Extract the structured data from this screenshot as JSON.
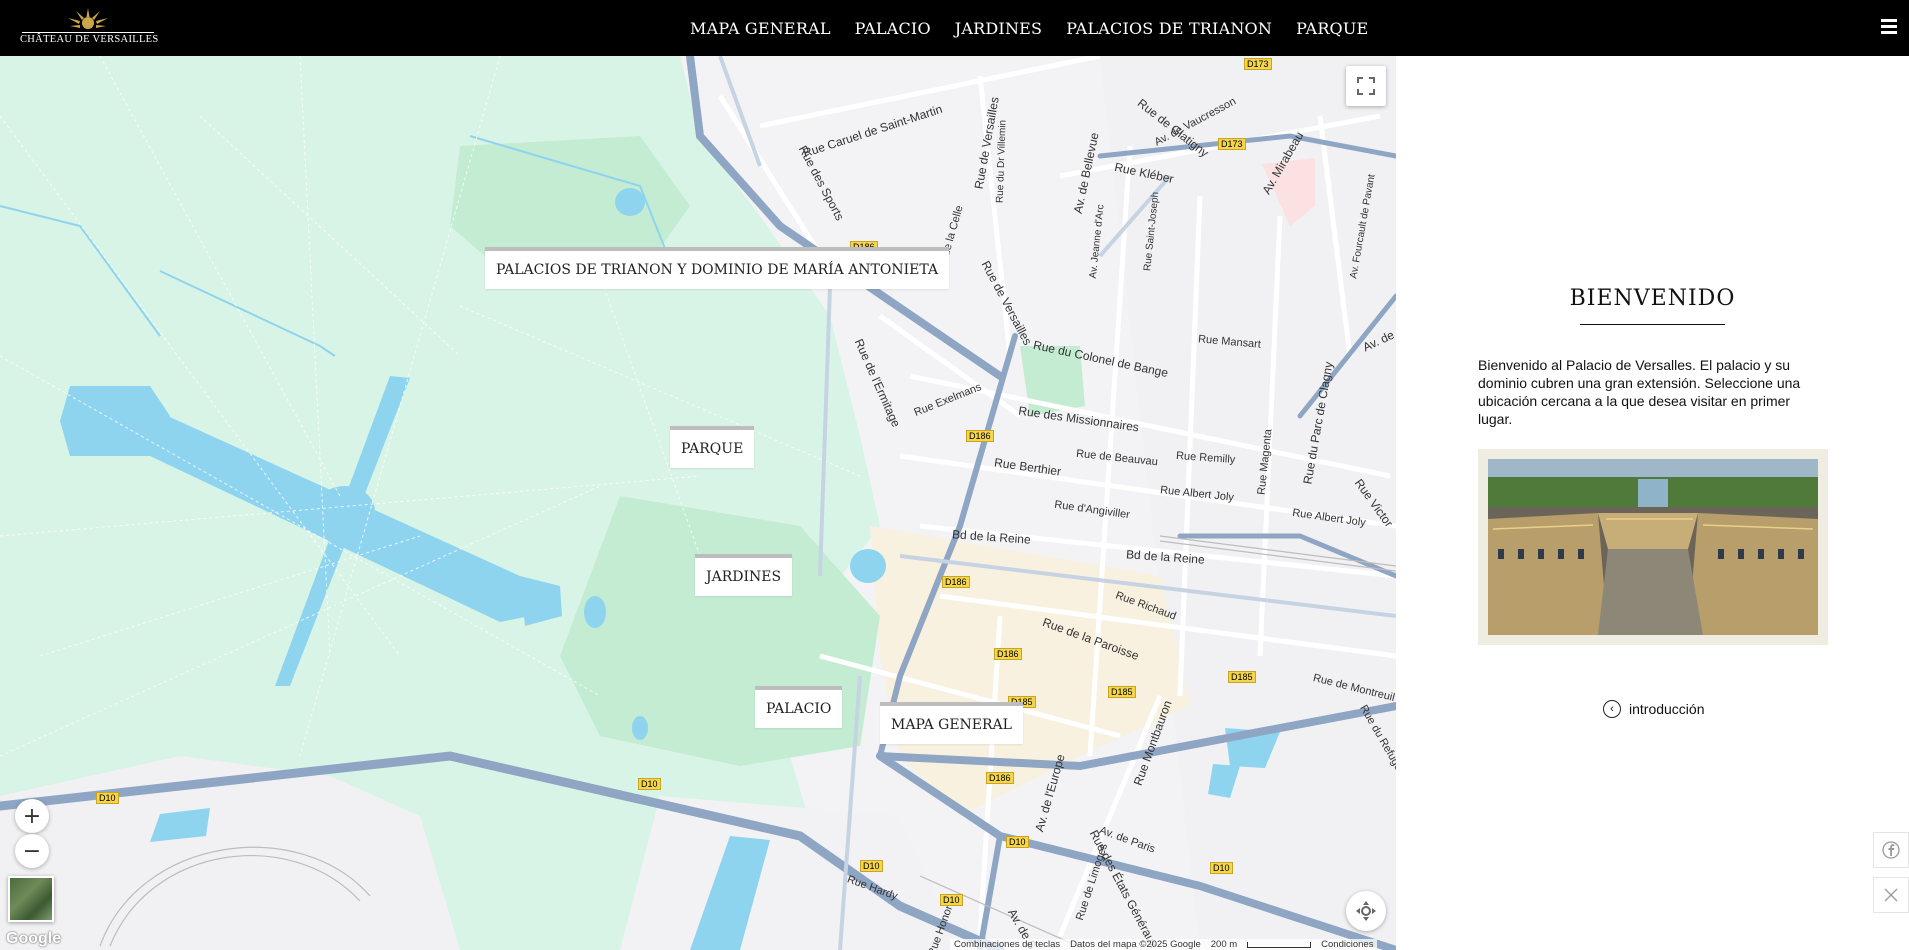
{
  "header": {
    "logo_text": "CHÂTEAU DE VERSAILLES",
    "nav": [
      {
        "label": "MAPA GENERAL"
      },
      {
        "label": "PALACIO"
      },
      {
        "label": "JARDINES"
      },
      {
        "label": "PALACIOS DE TRIANON"
      },
      {
        "label": "PARQUE"
      }
    ],
    "menu_icon": "hamburger-icon"
  },
  "map": {
    "poi_labels": {
      "trianon": "PALACIOS DE TRIANON Y DOMINIO DE MARÍA ANTONIETA",
      "parque": "PARQUE",
      "jardines": "JARDINES",
      "palacio": "PALACIO",
      "mapa_general": "MAPA GENERAL"
    },
    "streets": {
      "caruel": "Rue Caruel de Saint-Martin",
      "sports": "Rue des Sports",
      "versailles": "Rue de Versailles",
      "villemin": "Rue du Dr Villemin",
      "bellevue": "Av. de Bellevue",
      "glatigny": "Rue de Glatigny",
      "vaucresson": "Av. de Vaucresson",
      "mirabeau": "Av. Mirabeau",
      "kleber": "Rue Kléber",
      "jeanne_arc": "Av. Jeanne d'Arc",
      "saint_joseph": "Rue Saint-Joseph",
      "la_celle": "Rue de la Celle",
      "fourcault": "Av. Fourcault de Pavant",
      "ermitage": "Rue de l'Ermitage",
      "colonel_bange": "Rue du Colonel de Bange",
      "mansart": "Rue Mansart",
      "exelmans": "Rue Exelmans",
      "missionnaires": "Rue des Missionnaires",
      "parc_clagny": "Rue du Parc de Clagny",
      "magenta": "Rue Magenta",
      "berthier": "Rue Berthier",
      "beauvau": "Rue de Beauvau",
      "remilly": "Rue Remilly",
      "albert_joly": "Rue Albert Joly",
      "albert_joly2": "Rue Albert Joly",
      "angiviller": "Rue d'Angiviller",
      "victor": "Rue Victor",
      "reine1": "Bd de la Reine",
      "reine2": "Bd de la Reine",
      "richaud": "Rue Richaud",
      "paroisse": "Rue de la Paroisse",
      "montreuil": "Rue de Montreuil",
      "refuge": "Rue du Refuge",
      "europe": "Av. de l'Europe",
      "montbauron": "Rue Montbauron",
      "paris": "Av. de Paris",
      "etats_generaux": "Rue des États Généraux",
      "limoges": "Rue de Limoges",
      "hardy": "Rue Hardy",
      "honore": "Rue Honoré",
      "av_de_s": "Av. de S",
      "av_de": "Av. de"
    },
    "road_shields": {
      "d173a": "D173",
      "d173b": "D173",
      "d186a": "D186",
      "d186b": "D186",
      "d186c": "D186",
      "d186d": "D186",
      "d186e": "D186",
      "d185a": "D185",
      "d185b": "D185",
      "d185c": "D185",
      "d10a": "D10",
      "d10b": "D10",
      "d10c": "D10",
      "d10d": "D10",
      "d10e": "D10",
      "d10f": "D10"
    },
    "controls": {
      "fullscreen_icon": "fullscreen-icon",
      "zoom_in": "+",
      "zoom_out": "−",
      "pegman_icon": "move-icon"
    },
    "google_logo": "Google",
    "attribution": {
      "shortcuts": "Combinaciones de teclas",
      "data": "Datos del mapa ©2025 Google",
      "scale": "200 m",
      "terms": "Condiciones"
    },
    "colors": {
      "park": "#d8f4e6",
      "garden": "#c3ecd2",
      "water": "#8fd4ef",
      "road_major": "#8ea6c4",
      "urban": "#f3f3f5"
    }
  },
  "panel": {
    "title": "BIENVENIDO",
    "text": "Bienvenido al Palacio de Versalles. El palacio y su dominio cubren una gran extensión. Seleccione una ubicación cercana a la que desea visitar en primer lugar.",
    "intro_link": "introducción",
    "share": [
      "facebook-icon",
      "x-icon"
    ]
  }
}
